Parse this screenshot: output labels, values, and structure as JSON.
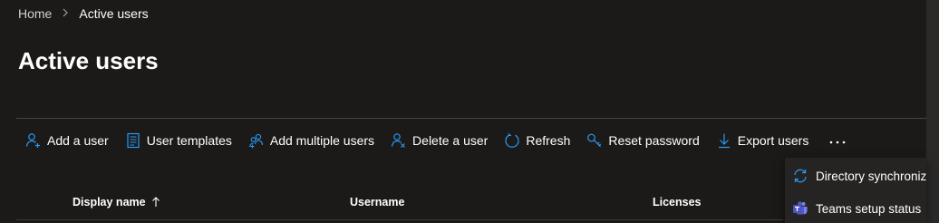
{
  "breadcrumb": {
    "home": "Home",
    "separator": ">",
    "current": "Active users"
  },
  "page": {
    "title": "Active users"
  },
  "toolbar": {
    "items": [
      {
        "label": "Add a user",
        "icon": "add-user-icon"
      },
      {
        "label": "User templates",
        "icon": "template-icon"
      },
      {
        "label": "Add multiple users",
        "icon": "add-multiple-users-icon"
      },
      {
        "label": "Delete a user",
        "icon": "delete-user-icon"
      },
      {
        "label": "Refresh",
        "icon": "refresh-icon"
      },
      {
        "label": "Reset password",
        "icon": "key-icon"
      },
      {
        "label": "Export users",
        "icon": "download-icon"
      }
    ],
    "more_icon": "more-icon"
  },
  "dropdown": {
    "items": [
      {
        "label": "Directory synchronization",
        "icon": "sync-icon"
      },
      {
        "label": "Teams setup status",
        "icon": "teams-icon"
      }
    ]
  },
  "table": {
    "columns": [
      {
        "label": "Display name",
        "sort": "ascending"
      },
      {
        "label": "Username"
      },
      {
        "label": "Licenses"
      }
    ]
  },
  "colors": {
    "background": "#1b1a19",
    "accent": "#2899f5",
    "text": "#ffffff",
    "muted": "#d2d0ce",
    "divider": "#484644",
    "menu_bg": "#252423"
  }
}
